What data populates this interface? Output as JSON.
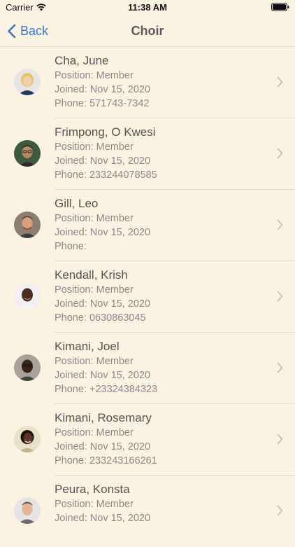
{
  "status_bar": {
    "carrier": "Carrier",
    "time": "11:38 AM",
    "icons": [
      "wifi-icon",
      "battery-icon"
    ]
  },
  "nav": {
    "back_label": "Back",
    "title": "Choir"
  },
  "colors": {
    "background": "#fbf3e1",
    "accent": "#3478d4"
  },
  "members": [
    {
      "name": "Cha, June",
      "position": "Position: Member",
      "joined": "Joined: Nov 15, 2020",
      "phone": "Phone: 571743-7342"
    },
    {
      "name": "Frimpong, O Kwesi",
      "position": "Position: Member",
      "joined": "Joined: Nov 15, 2020",
      "phone": "Phone: 233244078585"
    },
    {
      "name": "Gill, Leo",
      "position": "Position: Member",
      "joined": "Joined: Nov 15, 2020",
      "phone": "Phone:"
    },
    {
      "name": "Kendall, Krish",
      "position": "Position: Member",
      "joined": "Joined: Nov 15, 2020",
      "phone": "Phone: 0630863045"
    },
    {
      "name": "Kimani, Joel",
      "position": "Position: Member",
      "joined": "Joined: Nov 15, 2020",
      "phone": "Phone: +23324384323"
    },
    {
      "name": "Kimani, Rosemary",
      "position": "Position: Member",
      "joined": "Joined: Nov 15, 2020",
      "phone": "Phone: 233243166261"
    },
    {
      "name": "Peura, Konsta",
      "position": "Position: Member",
      "joined": "Joined: Nov 15, 2020",
      "phone": ""
    }
  ]
}
